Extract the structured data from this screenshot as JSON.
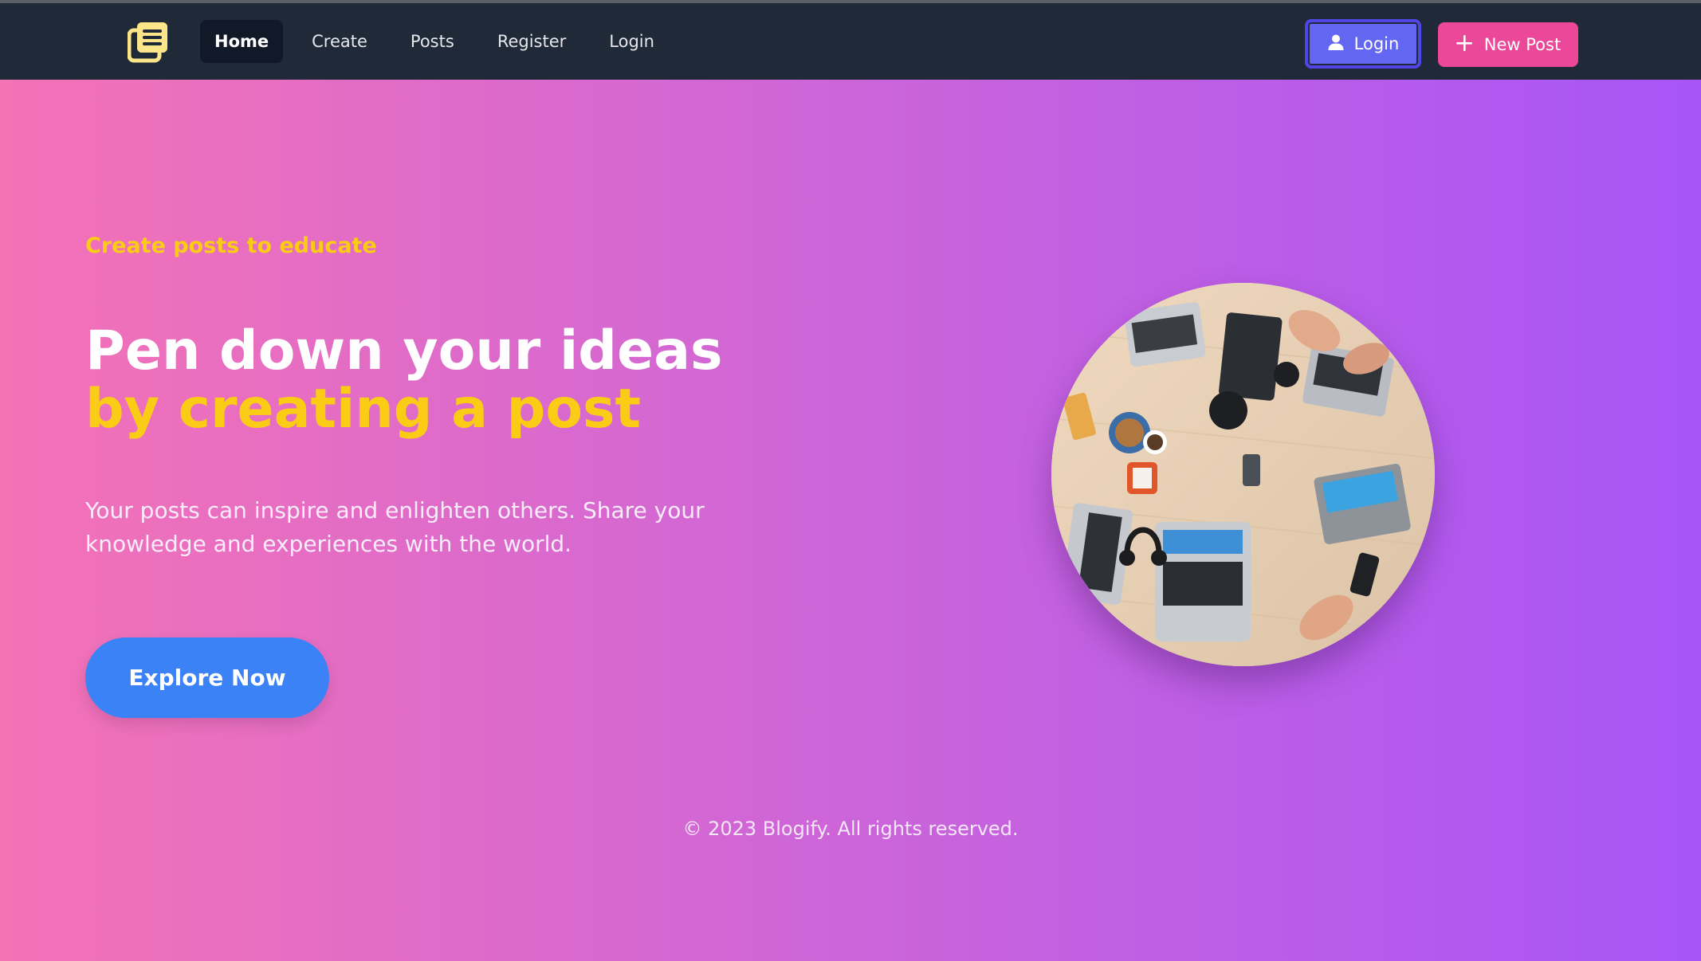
{
  "nav": {
    "logo_icon": "newspaper-icon",
    "links": [
      {
        "label": "Home",
        "active": true
      },
      {
        "label": "Create",
        "active": false
      },
      {
        "label": "Posts",
        "active": false
      },
      {
        "label": "Register",
        "active": false
      },
      {
        "label": "Login",
        "active": false
      }
    ],
    "login_button": {
      "label": "Login",
      "icon": "user-icon"
    },
    "new_post_button": {
      "label": "New Post",
      "icon": "plus-icon"
    }
  },
  "hero": {
    "eyebrow": "Create posts to educate",
    "headline_plain": "Pen down your ideas ",
    "headline_accent": "by creating a post",
    "lede": "Your posts can inspire and enlighten others. Share your knowledge and experiences with the world.",
    "cta_label": "Explore Now",
    "image": "workspace-laptops-photo"
  },
  "footer": {
    "text": "© 2023 Blogify. All rights reserved."
  },
  "colors": {
    "nav_bg": "#1f2937",
    "accent_yellow": "#facc15",
    "login_button": "#6366f1",
    "new_post_button": "#ec4899",
    "cta_button": "#3b82f6",
    "gradient_start": "#f472b6",
    "gradient_end": "#a855f7"
  }
}
